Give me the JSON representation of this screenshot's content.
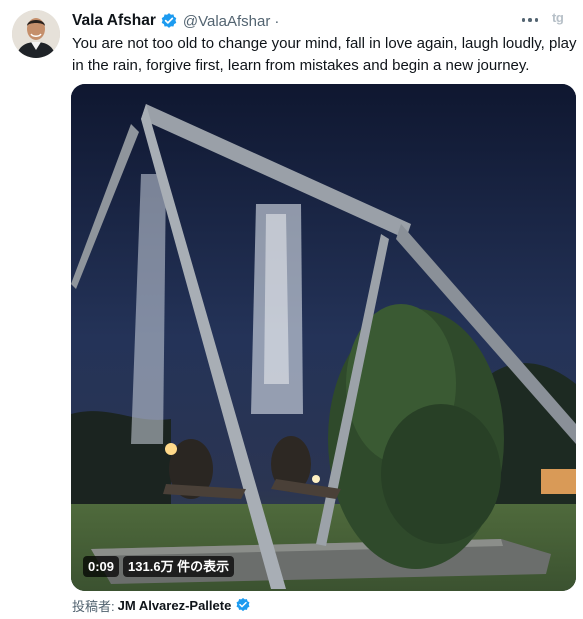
{
  "author": {
    "name": "Vala Afshar",
    "handle": "@ValaAfshar",
    "separator": "·",
    "verified_icon": "verified-badge-icon",
    "avatar_icon": "profile-avatar"
  },
  "tweet": {
    "text": "You are not too old to change your mind, fall in love again, laugh loudly, play in the rain, forgive first, learn from mistakes and begin a new journey."
  },
  "toolbar": {
    "more_icon": "more-options-icon",
    "extension_label": "tg"
  },
  "video": {
    "timestamp": "0:09",
    "views": "131.6万 件の表示"
  },
  "attribution": {
    "label": "投稿者:",
    "name": "JM Alvarez-Pallete"
  },
  "colors": {
    "verified": "#1d9bf0",
    "text_primary": "#0f1419",
    "text_secondary": "#536471"
  }
}
